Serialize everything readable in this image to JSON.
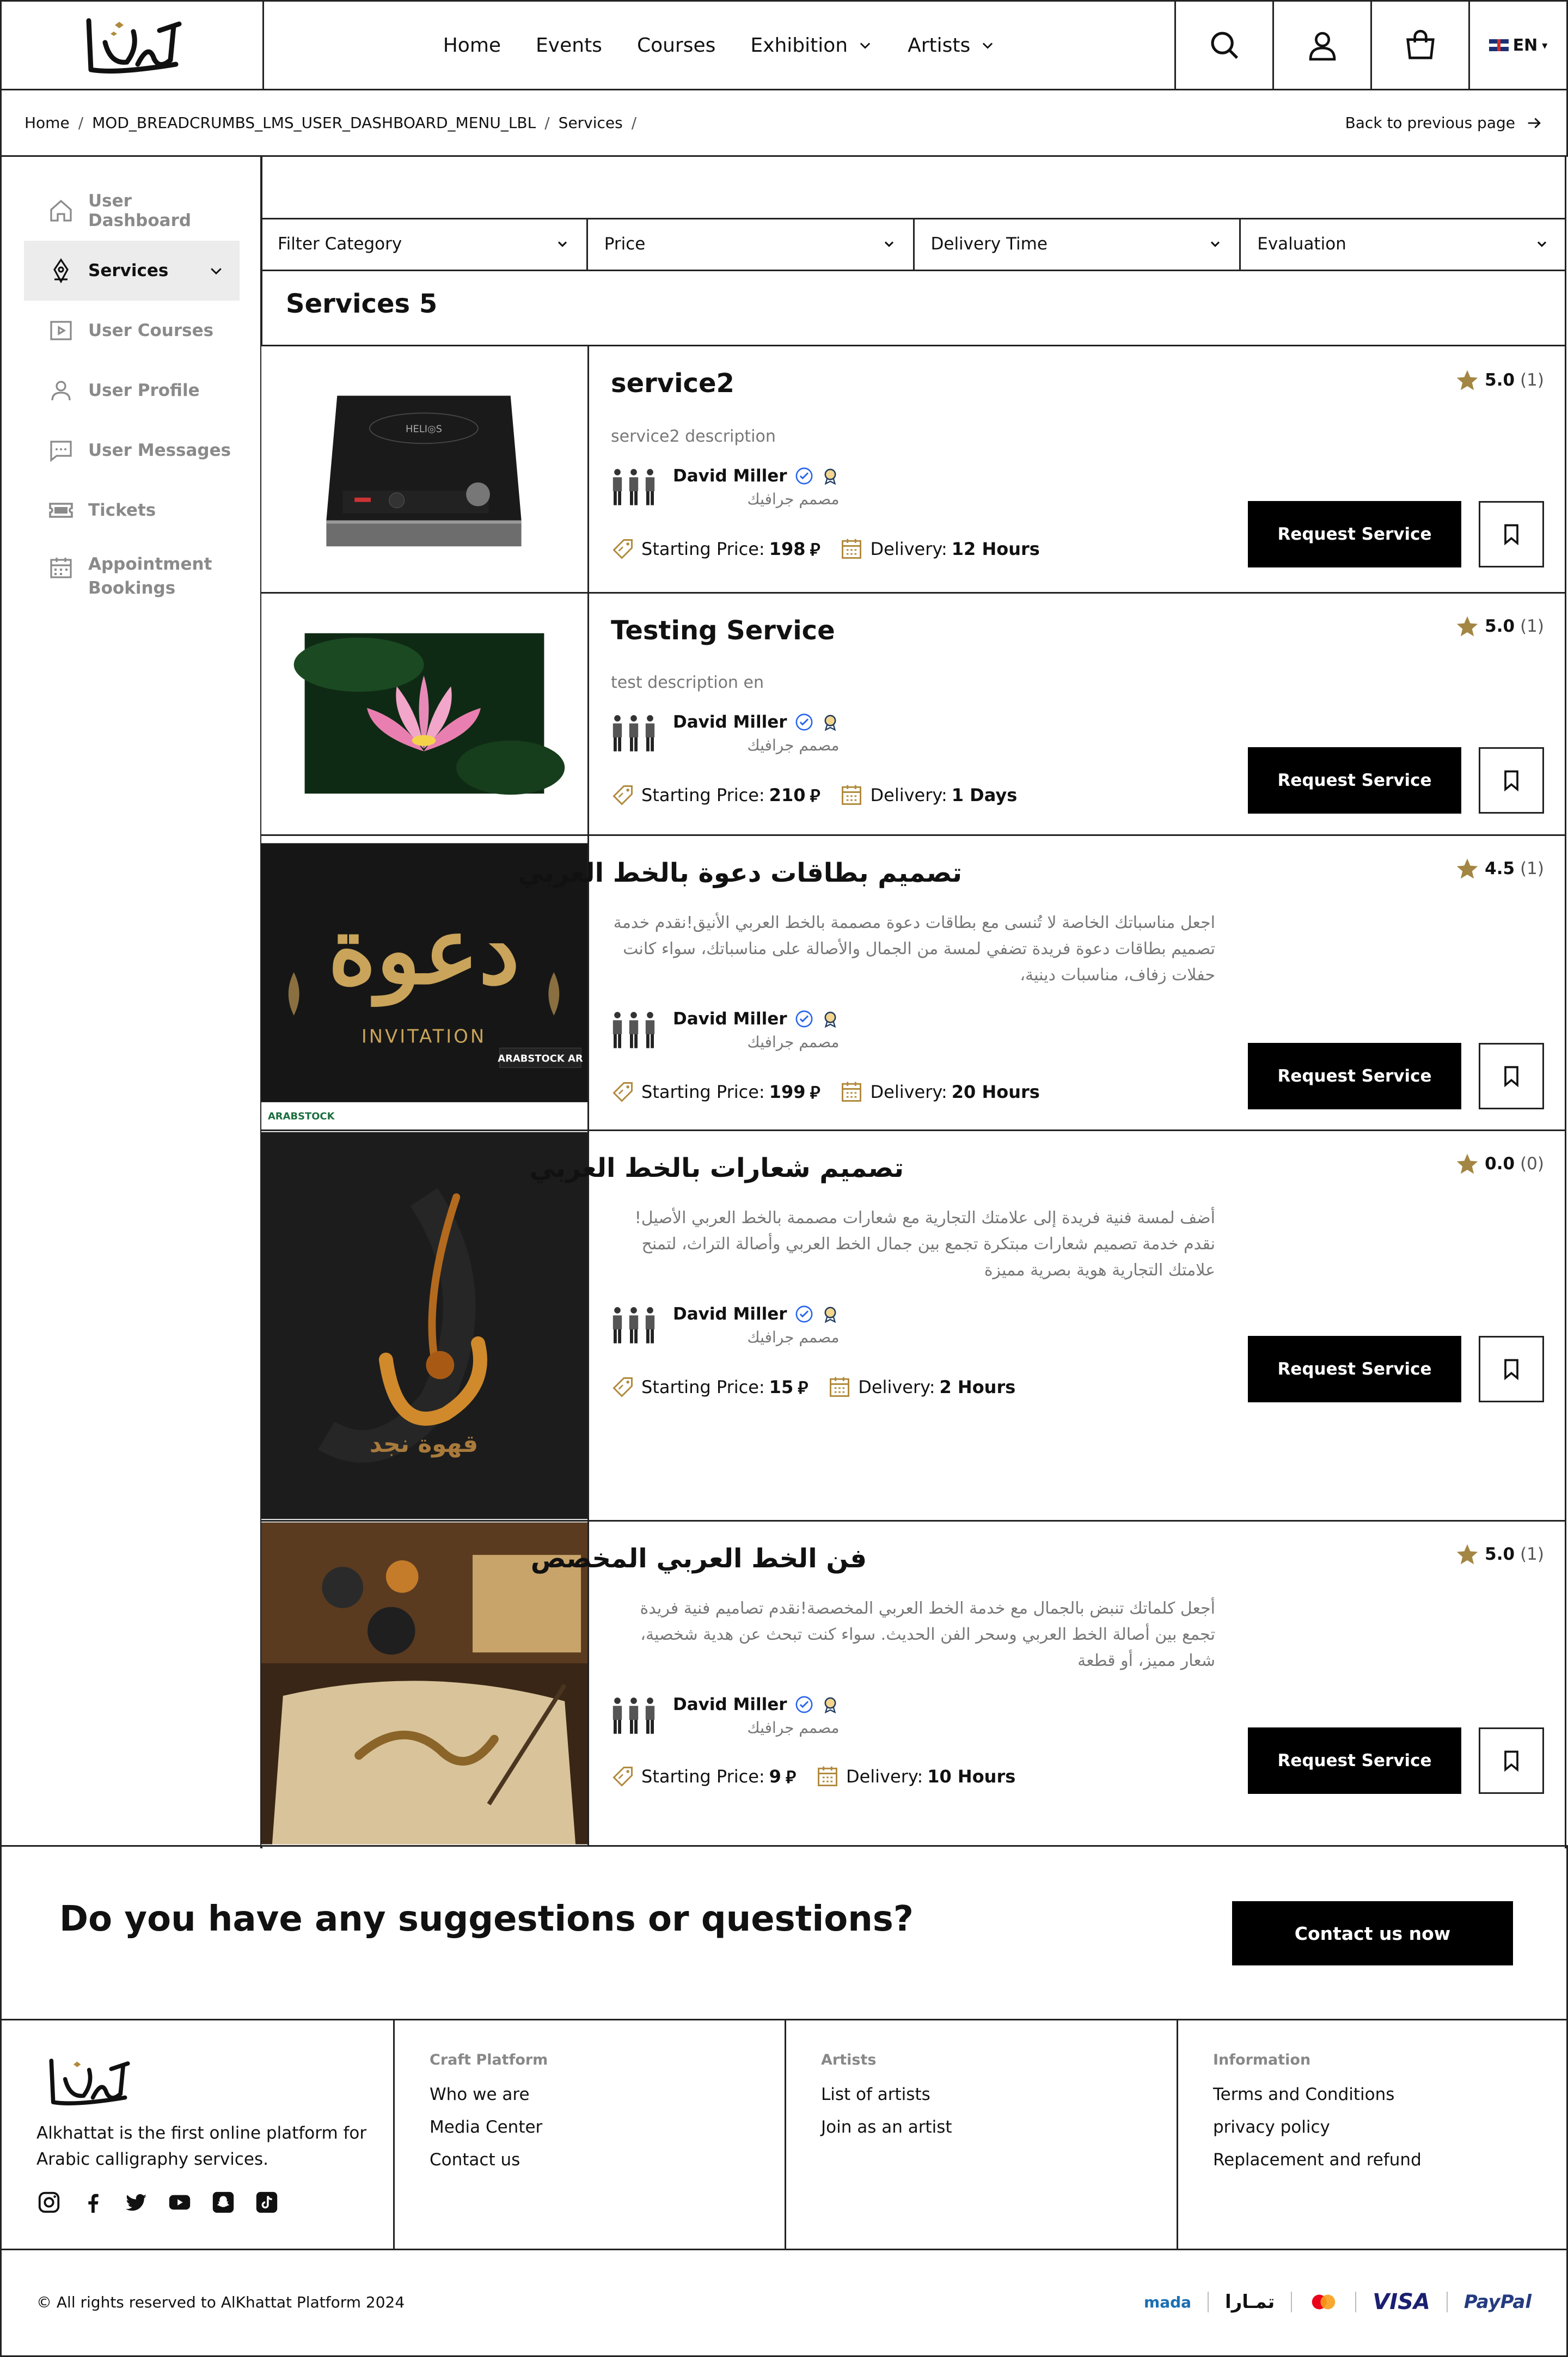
{
  "header": {
    "nav": [
      "Home",
      "Events",
      "Courses",
      "Exhibition",
      "Artists"
    ],
    "lang": "EN"
  },
  "breadcrumb": {
    "items": [
      "Home",
      "MOD_BREADCRUMBS_LMS_USER_DASHBOARD_MENU_LBL",
      "Services"
    ],
    "back": "Back to previous page"
  },
  "sidebar": {
    "items": [
      {
        "label": "User Dashboard",
        "icon": "home-icon"
      },
      {
        "label": "Services",
        "icon": "pen-nib-icon"
      },
      {
        "label": "User Courses",
        "icon": "play-icon"
      },
      {
        "label": "User Profile",
        "icon": "user-icon"
      },
      {
        "label": "User Messages",
        "icon": "chat-icon"
      },
      {
        "label": "Tickets",
        "icon": "ticket-icon"
      },
      {
        "label": "Appointment Bookings",
        "icon": "calendar-icon"
      }
    ]
  },
  "filters": [
    "Filter Category",
    "Price",
    "Delivery Time",
    "Evaluation"
  ],
  "services_heading": "Services 5",
  "labels": {
    "starting_price": "Starting Price:",
    "delivery": "Delivery:",
    "request": "Request Service",
    "currency": "⃁"
  },
  "services": [
    {
      "title": "service2",
      "desc": "service2 description",
      "author": "David Miller",
      "role": "مصمم جرافيك",
      "price": "198",
      "delivery": "12 Hours",
      "rating": "5.0",
      "count": "(1)"
    },
    {
      "title": "Testing Service",
      "desc": "test description en",
      "author": "David Miller",
      "role": "مصمم جرافيك",
      "price": "210",
      "delivery": "1 Days",
      "rating": "5.0",
      "count": "(1)"
    },
    {
      "title": "تصميم بطاقات دعوة بالخط العربي",
      "desc": "اجعل مناسباتك الخاصة لا تُنسى مع بطاقات دعوة مصممة بالخط العربي الأنيق!نقدم خدمة تصميم بطاقات دعوة فريدة تضفي لمسة من الجمال والأصالة على مناسباتك، سواء كانت حفلات زفاف، مناسبات دينية،",
      "author": "David Miller",
      "role": "مصمم جرافيك",
      "price": "199",
      "delivery": "20 Hours",
      "rating": "4.5",
      "count": "(1)"
    },
    {
      "title": "تصميم شعارات بالخط العربي",
      "desc": "أضف لمسة فنية فريدة إلى علامتك التجارية مع شعارات مصممة بالخط العربي الأصيل!نقدم خدمة تصميم شعارات مبتكرة تجمع بين جمال الخط العربي وأصالة التراث، لتمنح علامتك التجارية هوية بصرية مميزة",
      "author": "David Miller",
      "role": "مصمم جرافيك",
      "price": "15",
      "delivery": "2 Hours",
      "rating": "0.0",
      "count": "(0)"
    },
    {
      "title": "فن الخط العربي المخصص",
      "desc": "أجعل كلماتك تنبض بالجمال مع خدمة الخط العربي المخصصة!نقدم تصاميم فنية فريدة تجمع بين أصالة الخط العربي وسحر الفن الحديث. سواء كنت تبحث عن هدية شخصية، شعار مميز، أو قطعة",
      "author": "David Miller",
      "role": "مصمم جرافيك",
      "price": "9",
      "delivery": "10 Hours",
      "rating": "5.0",
      "count": "(1)"
    }
  ],
  "thumb_text": {
    "helios": "HELI◎S",
    "invitation": "INVITATION",
    "arabstock": "ARABSTOCK AR",
    "arabstock_small": "ARABSTOCK",
    "da3wa": "دعوة",
    "qahwa": "قهوة نجد"
  },
  "cta": {
    "question": "Do you have any suggestions or questions?",
    "button": "Contact us now"
  },
  "footer": {
    "brand_desc": "Alkhattat is the first online platform for Arabic calligraphy services.",
    "craft": {
      "title": "Craft Platform",
      "links": [
        "Who we are",
        "Media Center",
        "Contact us"
      ]
    },
    "artists": {
      "title": "Artists",
      "links": [
        "List of artists",
        "Join as an artist"
      ]
    },
    "info": {
      "title": "Information",
      "links": [
        "Terms and Conditions",
        "privacy policy",
        "Replacement and refund"
      ]
    },
    "socials": [
      "instagram-icon",
      "facebook-icon",
      "twitter-icon",
      "youtube-icon",
      "snapchat-icon",
      "tiktok-icon"
    ],
    "copyright": "© All rights reserved to AlKhattat Platform 2024",
    "payments": [
      "mada",
      "تمـارا",
      "VISA",
      "PayPal"
    ]
  },
  "colors": {
    "accent_gold": "#b08a3c",
    "black": "#000000",
    "border": "#222222"
  }
}
